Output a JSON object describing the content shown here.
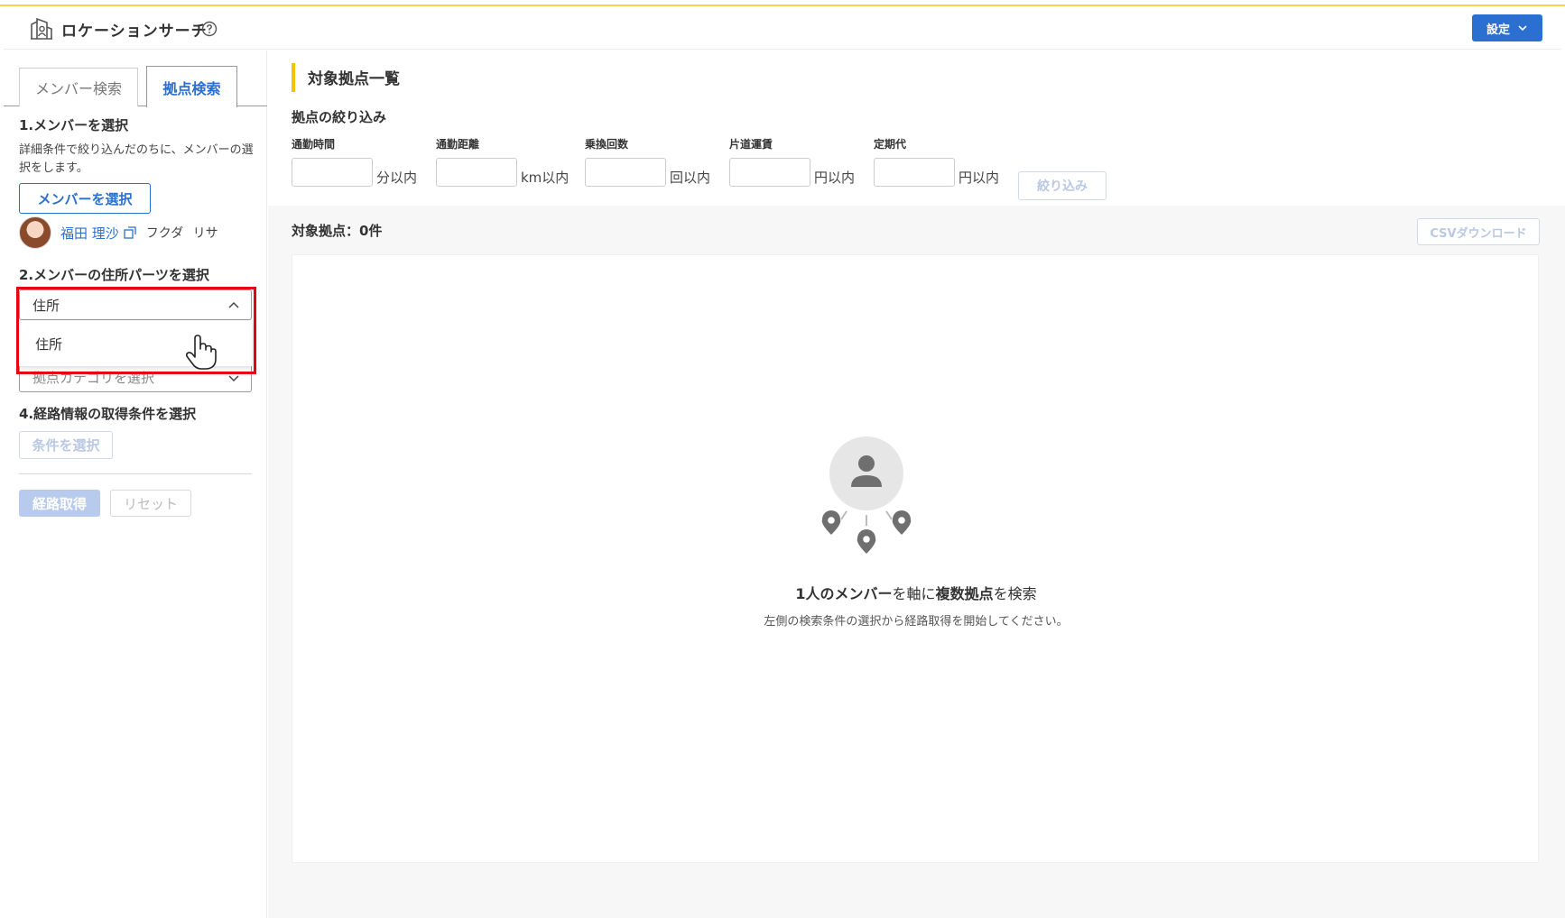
{
  "header": {
    "title": "ロケーションサーチ",
    "settings_label": "設定"
  },
  "sidebar": {
    "tabs": [
      {
        "label": "メンバー検索",
        "active": false
      },
      {
        "label": "拠点検索",
        "active": true
      }
    ],
    "step1": {
      "title": "1.メンバーを選択",
      "hint": "詳細条件で絞り込んだのちに、メンバーの選択をします。",
      "button_label": "メンバーを選択",
      "member_name": "福田 理沙",
      "member_kana": "フクダ リサ"
    },
    "step2": {
      "title": "2.メンバーの住所パーツを選択",
      "selected": "住所",
      "options": [
        "住所"
      ]
    },
    "step3": {
      "placeholder": "拠点カテゴリを選択"
    },
    "step4": {
      "title": "4.経路情報の取得条件を選択",
      "button_label": "条件を選択"
    },
    "actions": {
      "route_label": "経路取得",
      "reset_label": "リセット"
    }
  },
  "main": {
    "section_title": "対象拠点一覧",
    "filter_title": "拠点の絞り込み",
    "filters": [
      {
        "label": "通勤時間",
        "unit": "分以内"
      },
      {
        "label": "通勤距離",
        "unit": "km以内"
      },
      {
        "label": "乗換回数",
        "unit": "回以内"
      },
      {
        "label": "片道運賃",
        "unit": "円以内"
      },
      {
        "label": "定期代",
        "unit": "円以内"
      }
    ],
    "filter_button_label": "絞り込み",
    "count_label": "対象拠点：0件",
    "csv_button_label": "CSVダウンロード",
    "empty": {
      "main_1": "1人のメンバー",
      "main_2": "を軸に",
      "main_3": "複数拠点",
      "main_4": "を検索",
      "sub": "左側の検索条件の選択から経路取得を開始してください。"
    }
  },
  "colors": {
    "accent": "#2b6fd1",
    "highlight": "#e50012",
    "section_bar": "#f3c400"
  }
}
